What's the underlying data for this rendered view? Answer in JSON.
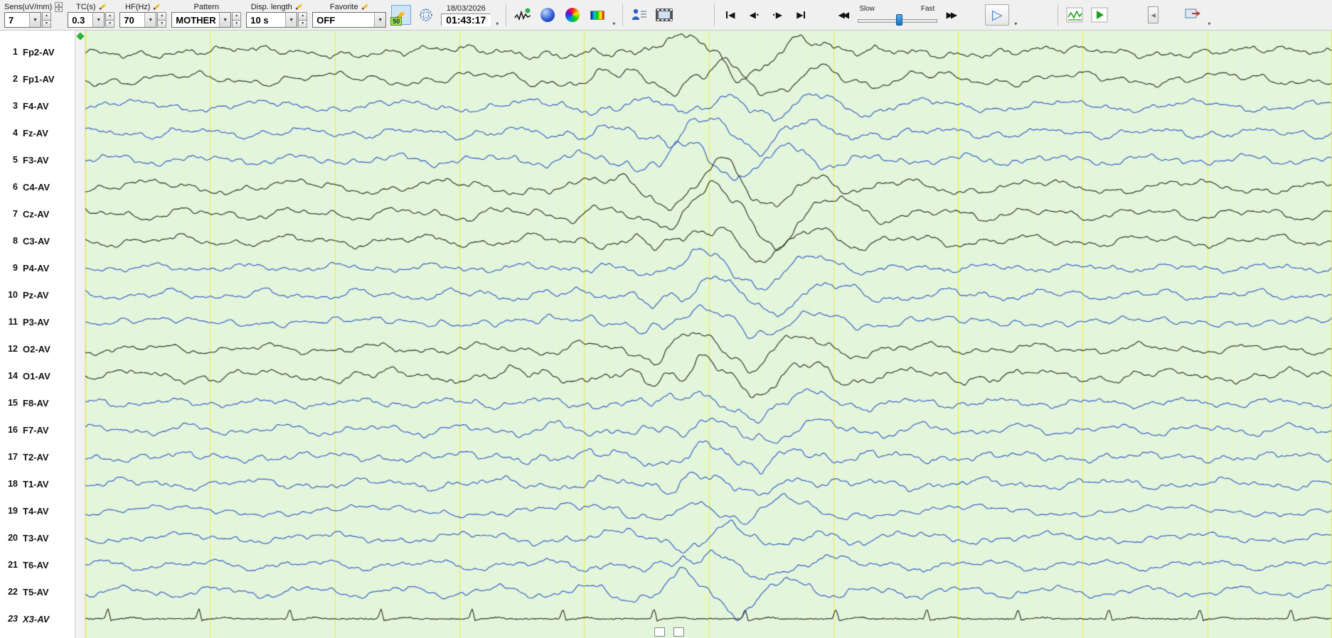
{
  "toolbar": {
    "sens": {
      "label": "Sens(uV/mm)",
      "value": "7"
    },
    "tc": {
      "label": "TC(s)",
      "value": "0.3"
    },
    "hf": {
      "label": "HF(Hz)",
      "value": "70"
    },
    "pattern": {
      "label": "Pattern",
      "value": "MOTHER"
    },
    "disp": {
      "label": "Disp. length",
      "value": "10 s"
    },
    "favorite": {
      "label": "Favorite",
      "value": "OFF"
    },
    "pen_badge": "50",
    "datetime": {
      "date": "18/03/2026",
      "time": "01:43:17"
    },
    "speed": {
      "slow": "Slow",
      "fast": "Fast"
    }
  },
  "channels": [
    {
      "num": "1",
      "label": "Fp2-AV",
      "color": "black",
      "baseline": 30,
      "amp": 1.05,
      "eventAmp": 30,
      "type": "eeg"
    },
    {
      "num": "2",
      "label": "Fp1-AV",
      "color": "black",
      "baseline": 68,
      "amp": 1.05,
      "eventAmp": 32,
      "type": "eeg"
    },
    {
      "num": "3",
      "label": "F4-AV",
      "color": "blue",
      "baseline": 106,
      "amp": 0.9,
      "eventAmp": 25,
      "type": "eeg"
    },
    {
      "num": "4",
      "label": "Fz-AV",
      "color": "blue",
      "baseline": 144,
      "amp": 0.9,
      "eventAmp": 28,
      "type": "eeg"
    },
    {
      "num": "5",
      "label": "F3-AV",
      "color": "blue",
      "baseline": 182,
      "amp": 0.9,
      "eventAmp": 24,
      "type": "eeg"
    },
    {
      "num": "6",
      "label": "C4-AV",
      "color": "black",
      "baseline": 220,
      "amp": 1.0,
      "eventAmp": 30,
      "type": "eeg"
    },
    {
      "num": "7",
      "label": "Cz-AV",
      "color": "black",
      "baseline": 258,
      "amp": 1.0,
      "eventAmp": 34,
      "type": "eeg"
    },
    {
      "num": "8",
      "label": "C3-AV",
      "color": "black",
      "baseline": 296,
      "amp": 1.0,
      "eventAmp": 32,
      "type": "eeg"
    },
    {
      "num": "9",
      "label": "P4-AV",
      "color": "blue",
      "baseline": 334,
      "amp": 0.85,
      "eventAmp": 26,
      "type": "eeg"
    },
    {
      "num": "10",
      "label": "Pz-AV",
      "color": "blue",
      "baseline": 372,
      "amp": 0.85,
      "eventAmp": 30,
      "type": "eeg"
    },
    {
      "num": "11",
      "label": "P3-AV",
      "color": "blue",
      "baseline": 410,
      "amp": 0.85,
      "eventAmp": 24,
      "type": "eeg"
    },
    {
      "num": "12",
      "label": "O2-AV",
      "color": "black",
      "baseline": 448,
      "amp": 1.0,
      "eventAmp": 28,
      "type": "eeg"
    },
    {
      "num": "14",
      "label": "O1-AV",
      "color": "black",
      "baseline": 486,
      "amp": 1.0,
      "eventAmp": 30,
      "type": "eeg"
    },
    {
      "num": "15",
      "label": "F8-AV",
      "color": "blue",
      "baseline": 524,
      "amp": 0.8,
      "eventAmp": 18,
      "type": "eeg"
    },
    {
      "num": "16",
      "label": "F7-AV",
      "color": "blue",
      "baseline": 562,
      "amp": 0.8,
      "eventAmp": 16,
      "type": "eeg"
    },
    {
      "num": "17",
      "label": "T2-AV",
      "color": "blue",
      "baseline": 600,
      "amp": 0.85,
      "eventAmp": 22,
      "type": "eeg"
    },
    {
      "num": "18",
      "label": "T1-AV",
      "color": "blue",
      "baseline": 638,
      "amp": 0.85,
      "eventAmp": 20,
      "type": "eeg"
    },
    {
      "num": "19",
      "label": "T4-AV",
      "color": "blue",
      "baseline": 676,
      "amp": 0.8,
      "eventAmp": 18,
      "type": "eeg"
    },
    {
      "num": "20",
      "label": "T3-AV",
      "color": "blue",
      "baseline": 714,
      "amp": 0.8,
      "eventAmp": 16,
      "type": "eeg"
    },
    {
      "num": "21",
      "label": "T6-AV",
      "color": "blue",
      "baseline": 752,
      "amp": 0.85,
      "eventAmp": 20,
      "type": "eeg"
    },
    {
      "num": "22",
      "label": "T5-AV",
      "color": "blue",
      "baseline": 790,
      "amp": 0.85,
      "eventAmp": 22,
      "type": "eeg"
    },
    {
      "num": "23",
      "label": "X3-AV",
      "color": "black",
      "baseline": 828,
      "amp": 0.2,
      "eventAmp": 0,
      "type": "ecg",
      "italic": true
    }
  ],
  "trace": {
    "seconds": 10,
    "seed": 7,
    "beat_interval_s": 0.73,
    "event_center_s": 5.3,
    "busy_center_s": 4.9
  },
  "colors": {
    "trace_bg": "#e3f6dc",
    "grid_major": "#eded3e",
    "grid_minor": "#e6e63c",
    "trace_black": "#23231a",
    "trace_blue": "#2a52c3",
    "accent_green": "#2db52d"
  }
}
